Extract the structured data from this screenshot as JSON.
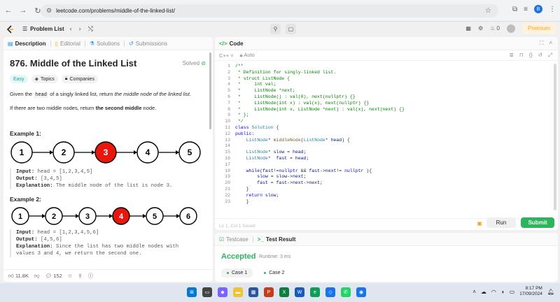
{
  "browser": {
    "url": "leetcode.com/problems/middle-of-the-linked-list/",
    "profile_initial": "B"
  },
  "nav": {
    "problem_list": "Problem List",
    "premium": "Premium",
    "streak": "0"
  },
  "left_tabs": [
    "Description",
    "Editorial",
    "Solutions",
    "Submissions"
  ],
  "problem": {
    "title": "876. Middle of the Linked List",
    "solved": "Solved",
    "tags": [
      "Easy",
      "Topics",
      "Companies"
    ],
    "para1_a": "Given the",
    "para1_code": "head",
    "para1_b": "of a singly linked list, return",
    "para1_c": "the middle node of the linked list",
    "para2_a": "If there are two middle nodes, return",
    "para2_b": "the second middle",
    "para2_c": "node.",
    "example1": {
      "label": "Example 1:",
      "nodes": [
        "1",
        "2",
        "3",
        "4",
        "5"
      ],
      "highlight": 2,
      "input_label": "Input:",
      "input": "head = [1,2,3,4,5]",
      "output_label": "Output:",
      "output": "[3,4,5]",
      "expl_label": "Explanation:",
      "explanation": "The middle node of the list is node 3."
    },
    "example2": {
      "label": "Example 2:",
      "nodes": [
        "1",
        "2",
        "3",
        "4",
        "5",
        "6"
      ],
      "highlight": 3,
      "input_label": "Input:",
      "input": "head = [1,2,3,4,5,6]",
      "output_label": "Output:",
      "output": "[4,5,6]",
      "expl_label": "Explanation:",
      "explanation_1": "Since the list has two middle nodes with",
      "explanation_2": "values 3 and 4, we return the second one."
    },
    "likes": "11.8K",
    "comments": "152"
  },
  "editor": {
    "tab": "Code",
    "language": "C++",
    "mode": "Auto",
    "status": "Ln 1, Col 1   Saved",
    "run": "Run",
    "submit": "Submit",
    "lines": [
      "/**",
      " * Definition for singly-linked list.",
      " * struct ListNode {",
      " *     int val;",
      " *     ListNode *next;",
      " *     ListNode() : val(0), next(nullptr) {}",
      " *     ListNode(int x) : val(x), next(nullptr) {}",
      " *     ListNode(int x, ListNode *next) : val(x), next(next) {}",
      " * };",
      " */",
      "class Solution {",
      "public:",
      "    ListNode* middleNode(ListNode* head) {",
      "",
      "    ListNode* slow = head;",
      "    ListNode*  fast = head;",
      "",
      "    while(fast!=nullptr && fast->next!= nullptr ){",
      "        slow = slow->next;",
      "        fast = fast->next->next;",
      "    }",
      "    return slow;",
      "    }"
    ]
  },
  "result": {
    "tabs": [
      "Testcase",
      "Test Result"
    ],
    "status": "Accepted",
    "runtime": "Runtime: 3 ms",
    "cases": [
      "Case 1",
      "Case 2"
    ]
  },
  "taskbar": {
    "time": "8:17 PM",
    "date": "17/09/2024"
  },
  "colors": {
    "accent_green": "#2db55d",
    "node_red": "#e8160c",
    "brand_orange": "#ffa116"
  }
}
